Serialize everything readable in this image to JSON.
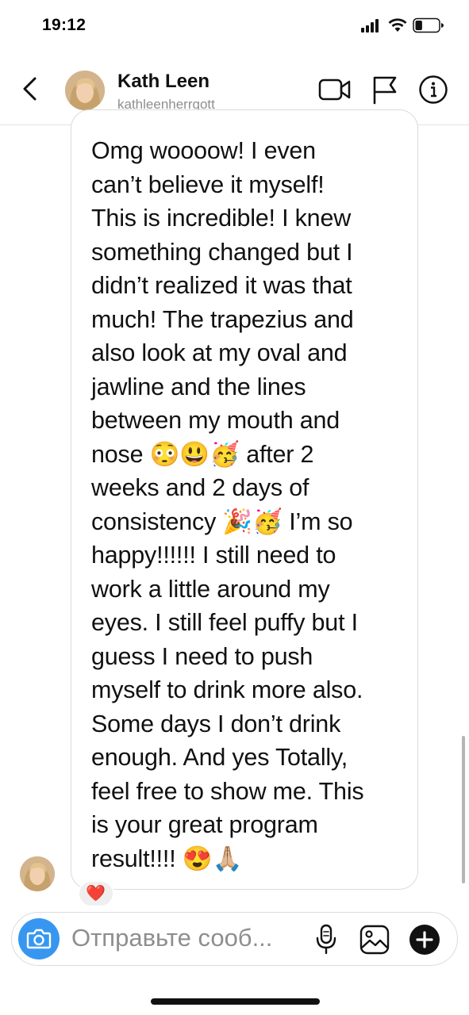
{
  "status_bar": {
    "time": "19:12",
    "battery_level": 0.3
  },
  "header": {
    "name": "Kath Leen",
    "username": "kathleenherrgott"
  },
  "message": {
    "text": "Omg woooow! I even\ncan’t believe it myself!\nThis is incredible! I knew\nsomething changed but I\ndidn’t realized it was that\nmuch! The trapezius and\nalso look at my oval and\njawline and the lines\nbetween my mouth and\nnose 😳😃🥳 after 2\nweeks and 2 days of\nconsistency 🎉🥳 I’m so\nhappy!!!!!! I still need to\nwork a little around my\neyes. I still feel puffy but I\nguess I need to push\nmyself to drink more also.\nSome days I don’t drink\nenough. And yes Totally,\nfeel free to show me. This\nis your great program\nresult!!!! 😍🙏🏼",
    "reaction": "❤️"
  },
  "composer": {
    "placeholder": "Отправьте сооб..."
  },
  "icons": {
    "back": "chevron-left-icon",
    "video": "video-camera-icon",
    "flag": "flag-icon",
    "info": "info-icon",
    "camera": "camera-icon",
    "mic": "microphone-icon",
    "gallery": "gallery-icon",
    "plus": "plus-icon"
  },
  "colors": {
    "accent": "#3797f0",
    "reaction": "#ee1d3b",
    "muted_text": "#8e8e8e"
  }
}
